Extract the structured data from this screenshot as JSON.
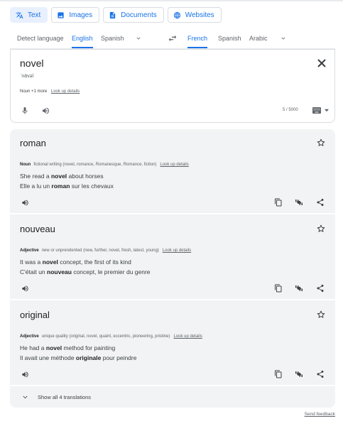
{
  "modes": [
    {
      "label": "Text",
      "icon": "translate-icon",
      "active": true
    },
    {
      "label": "Images",
      "icon": "image-icon",
      "active": false
    },
    {
      "label": "Documents",
      "icon": "document-icon",
      "active": false
    },
    {
      "label": "Websites",
      "icon": "globe-icon",
      "active": false
    }
  ],
  "source_languages": [
    "Detect language",
    "English",
    "Spanish"
  ],
  "source_active": "English",
  "target_languages": [
    "French",
    "Spanish",
    "Arabic"
  ],
  "target_active": "French",
  "source": {
    "text": "novel",
    "phonetic": "ˈnävəl",
    "pos": "Noun",
    "more": "+1 more",
    "lookup": "Look up details",
    "char_count": "5 / 5000"
  },
  "results": [
    {
      "word": "roman",
      "pos": "Noun",
      "sense": "fictional writing (novel, romance, Romanesque, Romance, fiction)",
      "lookup": "Look up details",
      "ex_en": {
        "before": "She read a ",
        "bold": "novel",
        "after": " about horses"
      },
      "ex_fr": {
        "before": "Elle a lu un ",
        "bold": "roman",
        "after": " sur les chevaux"
      }
    },
    {
      "word": "nouveau",
      "pos": "Adjective",
      "sense": "new or unprendented (new, further, novel, fresh, latest, young)",
      "lookup": "Look up details",
      "ex_en": {
        "before": "It was a ",
        "bold": "novel",
        "after": " concept, the first of its kind"
      },
      "ex_fr": {
        "before": "C'était un ",
        "bold": "nouveau",
        "after": " concept, le premier du genre"
      }
    },
    {
      "word": "original",
      "pos": "Adjective",
      "sense": "unique quality (original, novel, quaint, eccentric, pioneering, pristine)",
      "lookup": "Look up details",
      "ex_en": {
        "before": "He had a ",
        "bold": "novel",
        "after": " method for painting"
      },
      "ex_fr": {
        "before": "Il avait une méthode ",
        "bold": "originale",
        "after": " pour peindre"
      }
    }
  ],
  "show_all": "Show all 4 translations",
  "feedback": "Send feedback",
  "colors": {
    "accent": "#1a73e8",
    "active_tab_bg": "#e8f0fe",
    "panel_bg": "#f1f3f4"
  }
}
